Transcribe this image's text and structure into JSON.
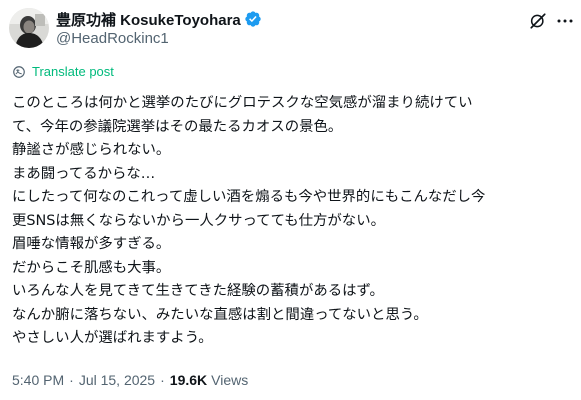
{
  "author": {
    "display_name": "豊原功補 KosukeToyohara",
    "handle": "@HeadRockinc1",
    "verified": true,
    "verified_color": "#1d9bf0"
  },
  "header_actions": {
    "grok_icon": "grok-slash-icon",
    "more_icon": "more-horizontal-icon"
  },
  "translate": {
    "label": "Translate post",
    "icon": "translate-icon",
    "color": "#00ba7c"
  },
  "post": {
    "lines": [
      "このところは何かと選挙のたびにグロテスクな空気感が溜まり続けてい",
      "て、今年の参議院選挙はその最たるカオスの景色。",
      "静謐さが感じられない。",
      "まあ闘ってるからな…",
      "にしたって何なのこれって虚しい酒を煽るも今や世界的にもこんなだし今",
      "更SNSは無くならないから一人クサってても仕方がない。",
      "眉唾な情報が多すぎる。",
      "だからこそ肌感も大事。",
      "いろんな人を見てきて生きてきた経験の蓄積があるはず。",
      "なんか腑に落ちない、みたいな直感は割と間違ってないと思う。",
      "やさしい人が選ばれますよう。"
    ]
  },
  "meta": {
    "time": "5:40 PM",
    "separator": "·",
    "date": "Jul 15, 2025",
    "views_count": "19.6K",
    "views_label": "Views"
  },
  "colors": {
    "text_primary": "#0f1419",
    "text_secondary": "#536471",
    "background": "#ffffff"
  }
}
